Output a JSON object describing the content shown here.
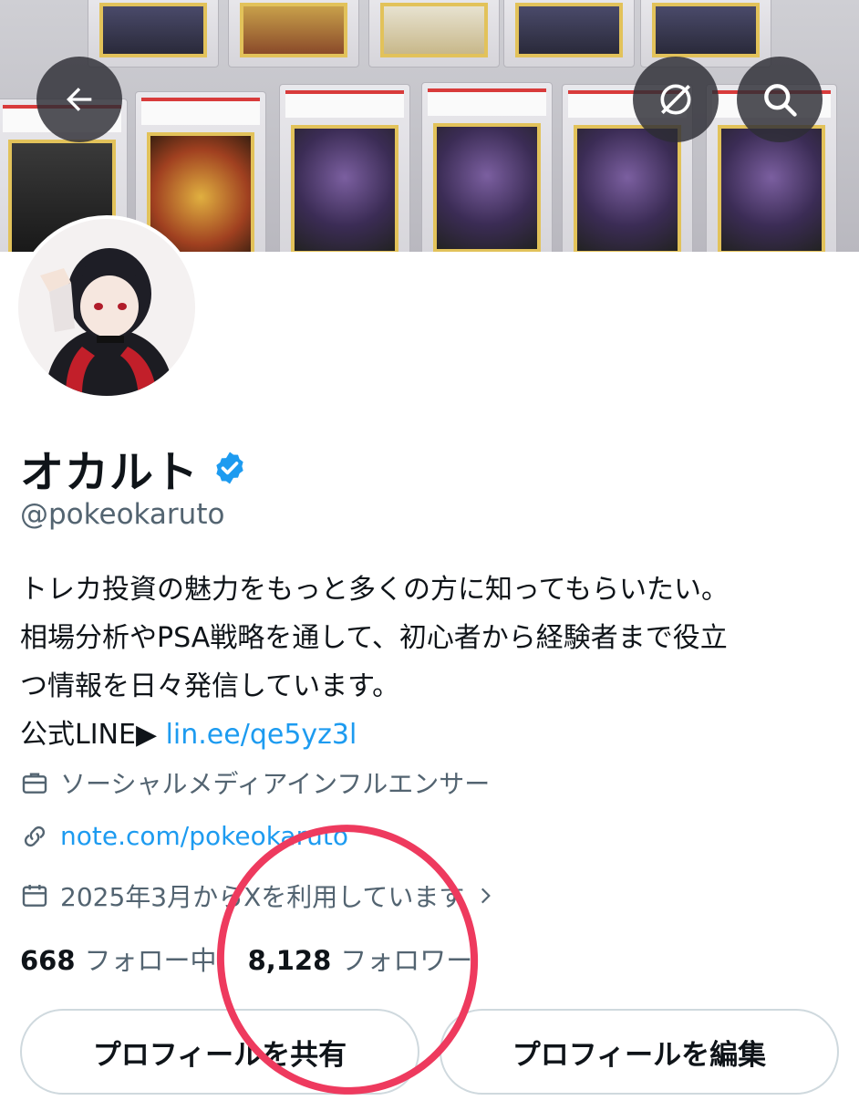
{
  "header": {
    "back_icon": "arrow-left-icon",
    "translate_icon": "globe-slash-icon",
    "search_icon": "search-icon"
  },
  "profile": {
    "display_name": "オカルト",
    "handle": "@pokeokaruto",
    "verified_icon": "verified-badge-icon",
    "bio_lines": [
      "トレカ投資の魅力をもっと多くの方に知ってもらいたい。",
      "相場分析やPSA戦略を通して、初心者から経験者まで役立",
      "つ情報を日々発信しています。"
    ],
    "line_prefix": "公式LINE▶",
    "line_link": "lin.ee/qe5yz3l",
    "category": "ソーシャルメディアインフルエンサー",
    "website": "note.com/pokeokaruto",
    "joined": "2025年3月からXを利用しています",
    "following_count": "668",
    "following_label": "フォロー中",
    "followers_count": "8,128",
    "followers_label": "フォロワー"
  },
  "buttons": {
    "share_profile": "プロフィールを共有",
    "edit_profile": "プロフィールを編集"
  },
  "colors": {
    "link": "#1d9bf0",
    "secondary_text": "#536471",
    "annotation_circle": "#ee3a5e",
    "verified": "#1d9bf0"
  }
}
